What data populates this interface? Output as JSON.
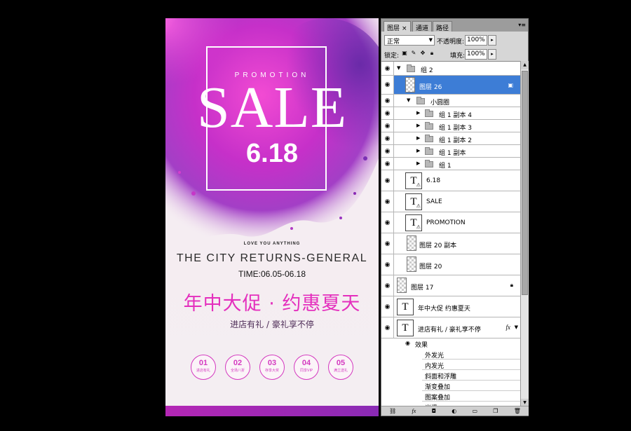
{
  "poster": {
    "promotion": "PROMOTION",
    "sale": "SALE",
    "date": "6.18",
    "love": "LOVE YOU ANYTHING",
    "city": "THE CITY RETURNS-GENERAL",
    "time": "TIME:06.05-06.18",
    "cn_title": "年中大促 · 约惠夏天",
    "cn_sub": "进店有礼 / 豪礼享不停",
    "circles": [
      {
        "n": "01",
        "t": "进店有礼"
      },
      {
        "n": "02",
        "t": "全场八折"
      },
      {
        "n": "03",
        "t": "存享大奖"
      },
      {
        "n": "04",
        "t": "同享VIP"
      },
      {
        "n": "05",
        "t": "满立送礼"
      }
    ],
    "colors": {
      "accent": "#e42fbd",
      "purple": "#8a2ab4"
    }
  },
  "panel": {
    "tabs": [
      "图层",
      "通道",
      "路径"
    ],
    "tab_close": "×",
    "blend_mode": "正常",
    "opacity_label": "不透明度:",
    "opacity_value": "100%",
    "lock_label": "锁定:",
    "fill_label": "填充:",
    "fill_value": "100%",
    "layers": {
      "group2": "组 2",
      "layer26": "图层 26",
      "small_circle": "小圆圈",
      "g1c4": "组 1 副本 4",
      "g1c3": "组 1 副本 3",
      "g1c2": "组 1 副本 2",
      "g1c": "组 1 副本",
      "g1": "组 1",
      "t618": "6.18",
      "tsale": "SALE",
      "tpromo": "PROMOTION",
      "l20c": "图层 20 副本",
      "l20": "图层 20",
      "l17": "图层 17",
      "tcn": "年中大促 约惠夏天",
      "tsub": "进店有礼 / 豪礼享不停",
      "effects": "效果"
    },
    "effects": [
      "外发光",
      "内发光",
      "斜面和浮雕",
      "渐变叠加",
      "图案叠加",
      "光泽"
    ],
    "fx": "fx",
    "thumb_letter": "T"
  }
}
